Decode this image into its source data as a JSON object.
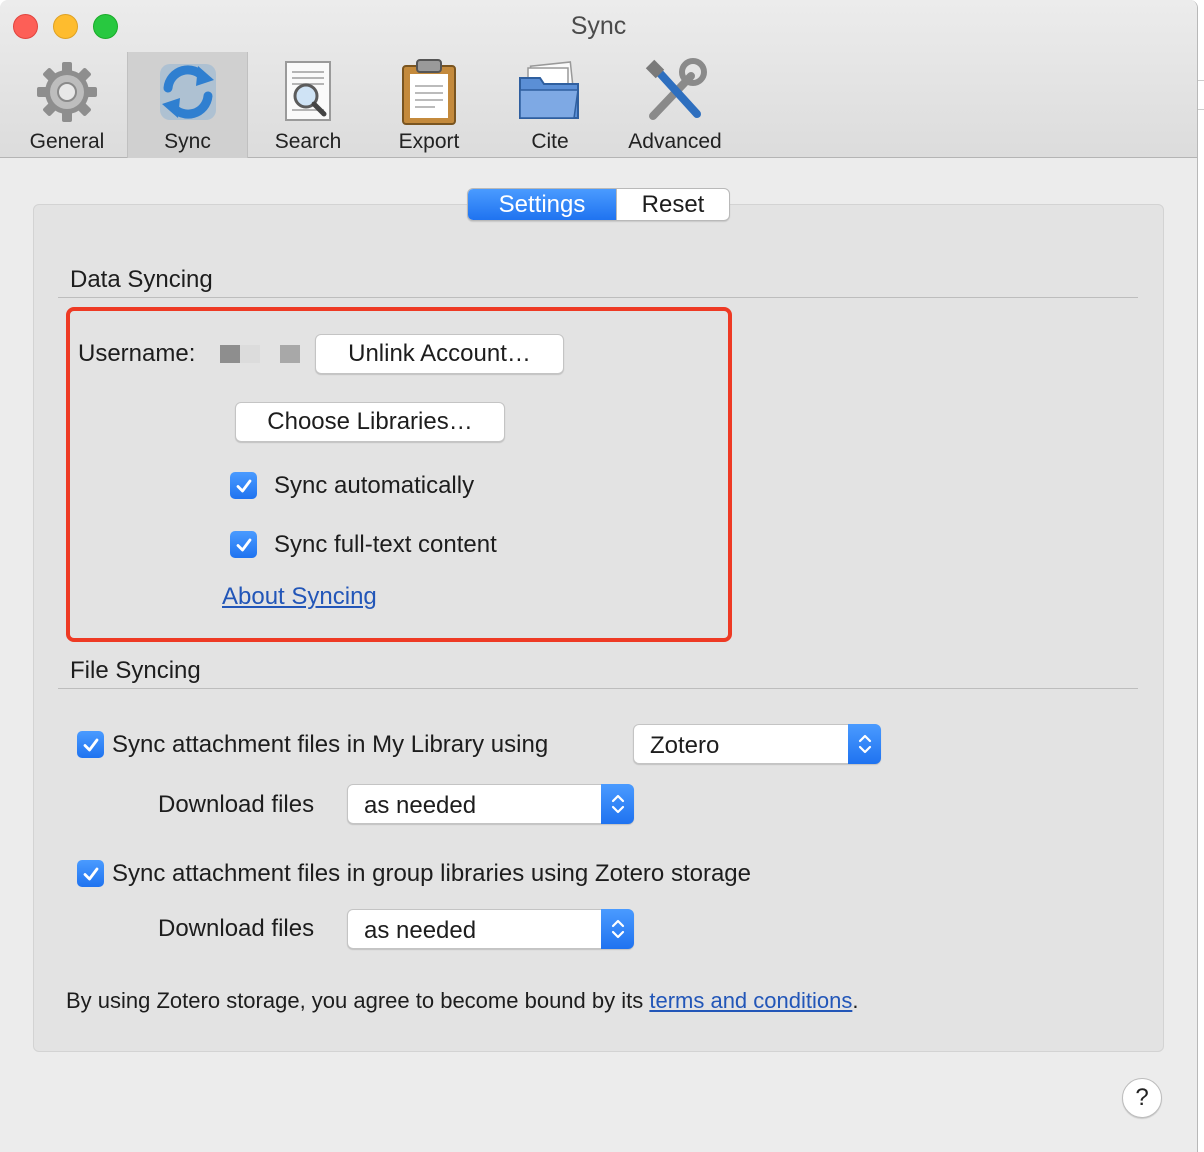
{
  "window": {
    "title": "Sync"
  },
  "toolbar": {
    "items": [
      {
        "label": "General",
        "icon": "gear-icon"
      },
      {
        "label": "Sync",
        "icon": "sync-icon"
      },
      {
        "label": "Search",
        "icon": "search-document-icon"
      },
      {
        "label": "Export",
        "icon": "clipboard-icon"
      },
      {
        "label": "Cite",
        "icon": "folder-icon"
      },
      {
        "label": "Advanced",
        "icon": "tools-icon"
      }
    ],
    "active": "Sync"
  },
  "tabs": {
    "settings_label": "Settings",
    "reset_label": "Reset",
    "selected": "Settings"
  },
  "data_syncing": {
    "title": "Data Syncing",
    "username_label": "Username:",
    "unlink_button": "Unlink Account…",
    "choose_libraries_button": "Choose Libraries…",
    "sync_automatically": {
      "label": "Sync automatically",
      "checked": true
    },
    "sync_fulltext": {
      "label": "Sync full-text content",
      "checked": true
    },
    "about_link": "About Syncing"
  },
  "file_syncing": {
    "title": "File Syncing",
    "my_library": {
      "label": "Sync attachment files in My Library using",
      "checked": true,
      "method": "Zotero",
      "download_label": "Download files",
      "download_value": "as needed"
    },
    "group_libraries": {
      "label": "Sync attachment files in group libraries using Zotero storage",
      "checked": true,
      "download_label": "Download files",
      "download_value": "as needed"
    }
  },
  "footer": {
    "text_before": "By using Zotero storage, you agree to become bound by its ",
    "link": "terms and conditions",
    "text_after": "."
  },
  "help_label": "?",
  "colors": {
    "accent": "#1f73f0",
    "highlight_box": "#ee3a24",
    "link": "#2256b8"
  }
}
